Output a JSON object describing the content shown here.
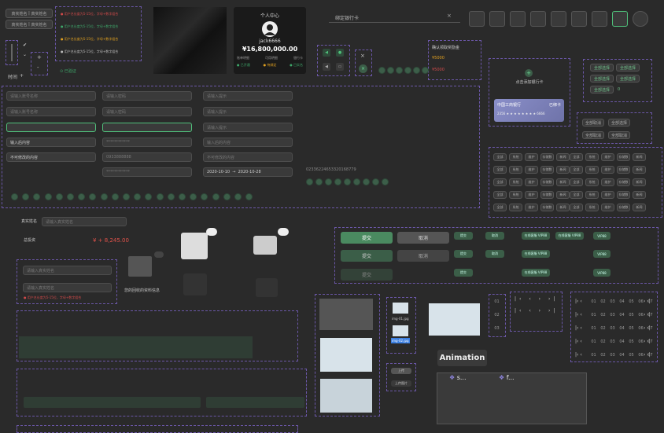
{
  "top_left": {
    "chip1": "真实姓名",
    "chip1b": "真实姓名",
    "chip2": "真实姓名",
    "chip2b": "真实姓名",
    "time_label": "时间"
  },
  "alerts": [
    "用户名长度为5-15位，字母+数字组合",
    "用户名长度为5-15位，字母+数字组合",
    "用户名长度为5-15位，字母+数字组合",
    "用户名长度为5-15位，字母+数字组合"
  ],
  "alert_colors": [
    "#d14a4a",
    "#3ea76a",
    "#e0a020",
    "#bbbbbb"
  ],
  "verified_label": "已验证",
  "profile": {
    "title": "个人中心",
    "username": "jack6666",
    "balance": "¥16,800,000.00",
    "stats": [
      "账单明细",
      "可用明细",
      "银行卡"
    ],
    "badges": [
      "已开通",
      "待绑定",
      "已实名"
    ]
  },
  "bank_search": {
    "value": "绑定银行卡"
  },
  "confirm_box": {
    "title": "确认领取奖励金",
    "v1": "¥5000",
    "v2": "¥5000"
  },
  "bank_card": {
    "add_label": "点击添加银行卡",
    "bank_name": "中国工商银行",
    "tag": "已绑卡",
    "number": "2356 ★ ★ ★ ★ ★ ★ ★ ★ 6666"
  },
  "tag_group1": [
    "全部选择",
    "全部选择",
    "全部选择",
    "全部选择",
    "全部选择"
  ],
  "tag_group1_zero": "0",
  "tag_group2": [
    "全部取消",
    "全部选择",
    "全部取消",
    "全部取消"
  ],
  "form_inputs": {
    "col1": [
      "请输入账号名称",
      "请输入账号名称",
      "",
      "输入后内容",
      "不可修改的内容"
    ],
    "col2": [
      "请输入密码",
      "请输入密码",
      "",
      "************",
      "0933888888",
      "************"
    ],
    "col3": [
      "请输入提示",
      "请输入提示",
      "请输入提示",
      "输入后的内容",
      "不可修改的内容"
    ],
    "date_from": "2020-10-10",
    "date_to": "2020-10-28"
  },
  "long_number": "02336224653320168779",
  "category_tags": {
    "row": [
      "全部",
      "系统",
      "维护",
      "存储数",
      "新闻"
    ]
  },
  "real_name": {
    "label": "真实姓名",
    "placeholder": "请输入真实姓名"
  },
  "balance_row": {
    "label": "总投资",
    "value": "¥ + 8,245.00"
  },
  "left_form": {
    "fields": [
      "请输入真实姓名",
      "请输入真实姓名"
    ],
    "error": "用户名长度为5-15位，字母+数字组合"
  },
  "empty_state": "您的回收的资料信息",
  "buttons": {
    "primary": "提交",
    "secondary": "取消",
    "primary2": "提交",
    "secondary2": "取消",
    "primary3": "提交"
  },
  "small_buttons": [
    "提交",
    "取消",
    "在线客服 VIP88",
    "在线客服 VIP88",
    "VIP88"
  ],
  "small_buttons2": [
    "提交",
    "取消",
    "在线客服 VIP88",
    "VIP88"
  ],
  "small_buttons3": [
    "提交",
    "在线客服 VIP88",
    "VIP88"
  ],
  "file_names": [
    "img-01.jpg",
    "img-02.jpg"
  ],
  "file_btns": [
    "上传",
    "上传图片"
  ],
  "animation_label": "Animation",
  "anim_items": [
    "s...",
    "f..."
  ],
  "pages": [
    "01",
    "02",
    "03",
    "04",
    "05",
    "06",
    "07"
  ],
  "side_pages": [
    "01",
    "02",
    "03"
  ]
}
